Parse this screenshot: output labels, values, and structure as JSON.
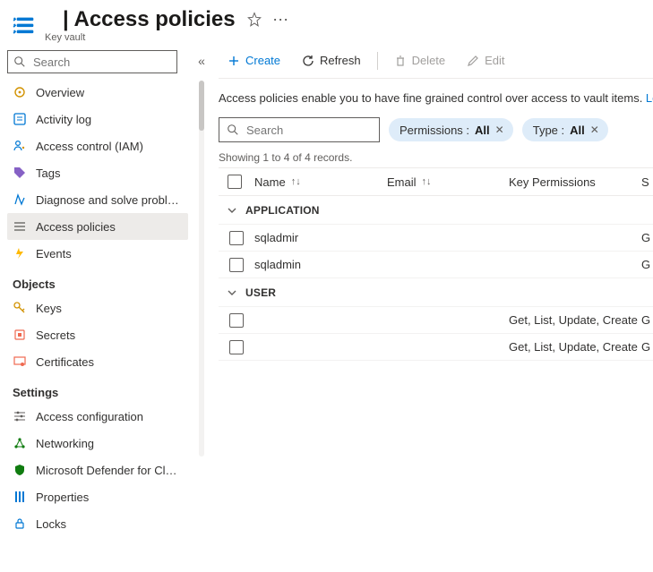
{
  "header": {
    "title_prefix": "| ",
    "title": "Access policies",
    "subtitle": "Key vault"
  },
  "sidebar": {
    "search_placeholder": "Search",
    "items_top": [
      {
        "icon": "overview-icon",
        "label": "Overview"
      },
      {
        "icon": "activity-log-icon",
        "label": "Activity log"
      },
      {
        "icon": "access-control-icon",
        "label": "Access control (IAM)"
      },
      {
        "icon": "tags-icon",
        "label": "Tags"
      },
      {
        "icon": "diagnose-icon",
        "label": "Diagnose and solve problems"
      },
      {
        "icon": "access-policies-icon",
        "label": "Access policies",
        "active": true
      },
      {
        "icon": "events-icon",
        "label": "Events"
      }
    ],
    "heading_objects": "Objects",
    "items_objects": [
      {
        "icon": "keys-icon",
        "label": "Keys"
      },
      {
        "icon": "secrets-icon",
        "label": "Secrets"
      },
      {
        "icon": "certificates-icon",
        "label": "Certificates"
      }
    ],
    "heading_settings": "Settings",
    "items_settings": [
      {
        "icon": "access-config-icon",
        "label": "Access configuration"
      },
      {
        "icon": "networking-icon",
        "label": "Networking"
      },
      {
        "icon": "defender-icon",
        "label": "Microsoft Defender for Cloud"
      },
      {
        "icon": "properties-icon",
        "label": "Properties"
      },
      {
        "icon": "locks-icon",
        "label": "Locks"
      }
    ]
  },
  "toolbar": {
    "create": "Create",
    "refresh": "Refresh",
    "delete": "Delete",
    "edit": "Edit"
  },
  "description": {
    "text": "Access policies enable you to have fine grained control over access to vault items. ",
    "link": "Learn more"
  },
  "filters": {
    "search_placeholder": "Search",
    "permissions_label": "Permissions : ",
    "permissions_value": "All",
    "type_label": "Type : ",
    "type_value": "All"
  },
  "status_line": "Showing 1 to 4 of 4 records.",
  "columns": {
    "name": "Name",
    "email": "Email",
    "key_permissions": "Key Permissions",
    "s": "S"
  },
  "groups": [
    {
      "label": "APPLICATION",
      "rows": [
        {
          "name": "sqladmir",
          "email": "",
          "key_permissions": "",
          "s": "G"
        },
        {
          "name": "sqladmin",
          "email": "",
          "key_permissions": "",
          "s": "G"
        }
      ]
    },
    {
      "label": "USER",
      "rows": [
        {
          "name": "",
          "email": "",
          "key_permissions": "Get, List, Update, Create, ...",
          "s": "G"
        },
        {
          "name": "",
          "email": "",
          "key_permissions": "Get, List, Update, Create, ...",
          "s": "G"
        }
      ]
    }
  ]
}
